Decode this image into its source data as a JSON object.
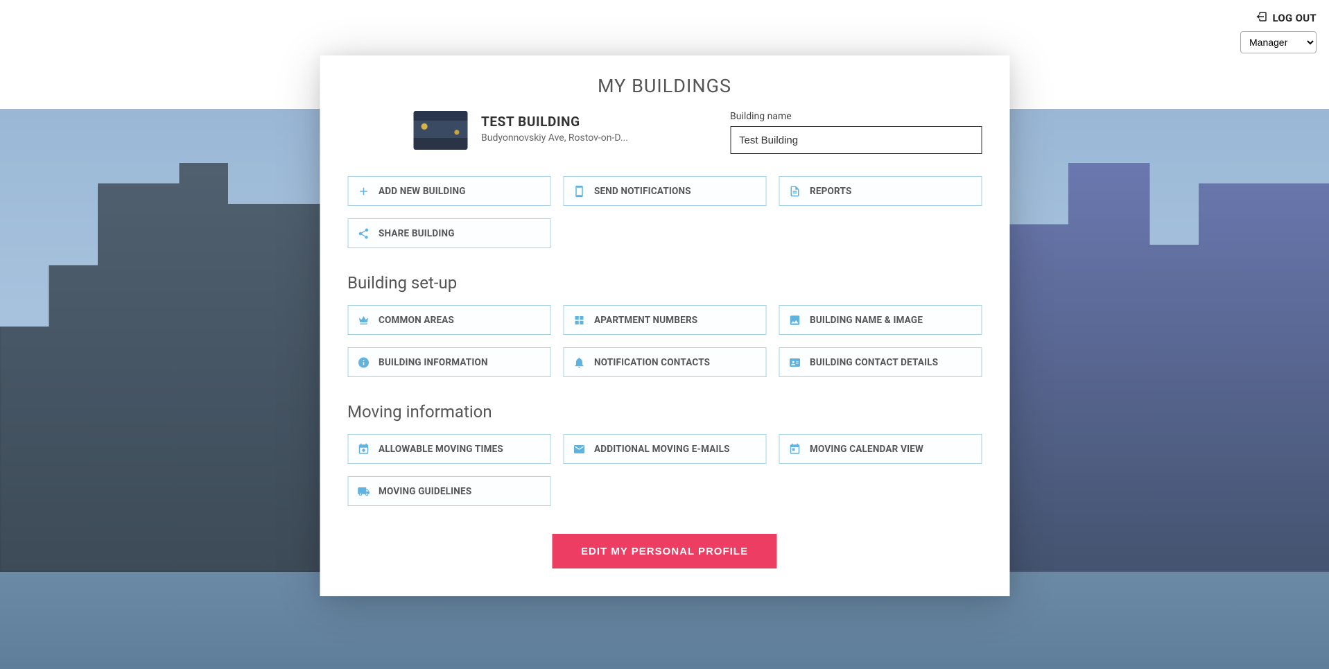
{
  "topbar": {
    "logout_label": "LOG OUT",
    "role_selected": "Manager"
  },
  "page": {
    "title": "MY BUILDINGS"
  },
  "building": {
    "name": "TEST BUILDING",
    "address": "Budyonnovskiy Ave, Rostov-on-D...",
    "name_field_label": "Building name",
    "name_field_value": "Test Building"
  },
  "actions": {
    "add_new_building": "ADD NEW BUILDING",
    "send_notifications": "SEND NOTIFICATIONS",
    "reports": "REPORTS",
    "share_building": "SHARE BUILDING"
  },
  "sections": {
    "setup_title": "Building set-up",
    "moving_title": "Moving information"
  },
  "setup": {
    "common_areas": "COMMON AREAS",
    "apartment_numbers": "APARTMENT NUMBERS",
    "building_name_image": "BUILDING NAME & IMAGE",
    "building_information": "BUILDING INFORMATION",
    "notification_contacts": "NOTIFICATION CONTACTS",
    "building_contact_details": "BUILDING CONTACT DETAILS"
  },
  "moving": {
    "allowable_moving_times": "ALLOWABLE MOVING TIMES",
    "additional_moving_emails": "ADDITIONAL MOVING E-MAILS",
    "moving_calendar_view": "MOVING CALENDAR VIEW",
    "moving_guidelines": "MOVING GUIDELINES"
  },
  "cta": {
    "edit_profile": "EDIT MY PERSONAL PROFILE"
  }
}
